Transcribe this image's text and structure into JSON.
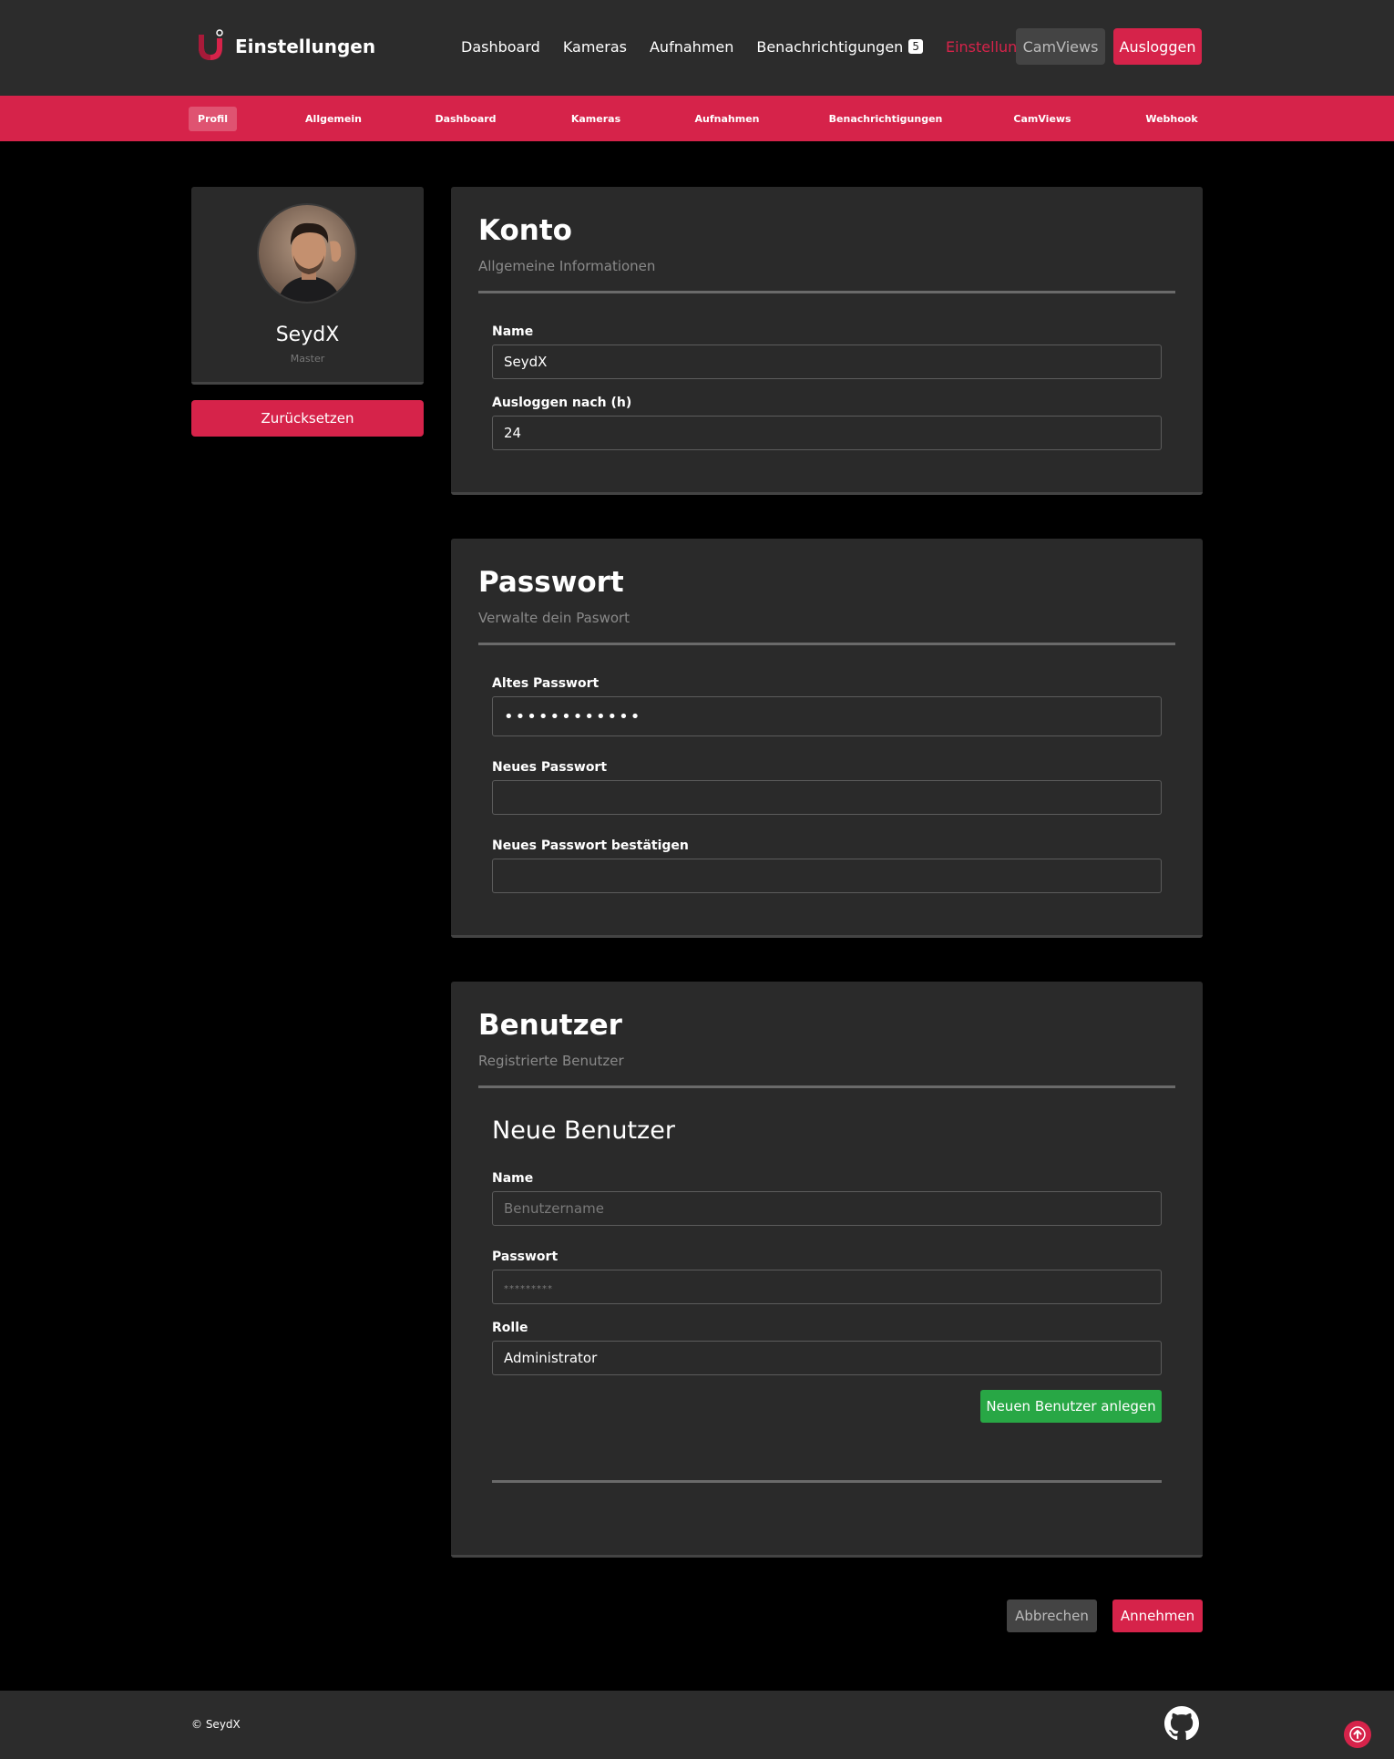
{
  "header": {
    "brand_title": "Einstellungen",
    "nav": [
      {
        "label": "Dashboard"
      },
      {
        "label": "Kameras"
      },
      {
        "label": "Aufnahmen"
      },
      {
        "label": "Benachrichtigungen",
        "badge": "5"
      },
      {
        "label": "Einstellungen",
        "active": true
      }
    ],
    "camviews_label": "CamViews",
    "logout_label": "Ausloggen"
  },
  "subnav": {
    "items": [
      {
        "label": "Profil",
        "active": true
      },
      {
        "label": "Allgemein"
      },
      {
        "label": "Dashboard"
      },
      {
        "label": "Kameras"
      },
      {
        "label": "Aufnahmen"
      },
      {
        "label": "Benachrichtigungen"
      },
      {
        "label": "CamViews"
      },
      {
        "label": "Webhook"
      }
    ]
  },
  "profile": {
    "name": "SeydX",
    "role": "Master",
    "reset_label": "Zurücksetzen"
  },
  "account": {
    "title": "Konto",
    "subtitle": "Allgemeine Informationen",
    "name_label": "Name",
    "name_value": "SeydX",
    "logout_label": "Ausloggen nach (h)",
    "logout_value": "24"
  },
  "password": {
    "title": "Passwort",
    "subtitle": "Verwalte dein Paswort",
    "old_label": "Altes Passwort",
    "old_value": "••••••••••••",
    "new_label": "Neues Passwort",
    "new_value": "",
    "confirm_label": "Neues Passwort bestätigen",
    "confirm_value": ""
  },
  "users": {
    "title": "Benutzer",
    "subtitle": "Registrierte Benutzer",
    "new_user_title": "Neue Benutzer",
    "name_label": "Name",
    "name_placeholder": "Benutzername",
    "password_label": "Passwort",
    "password_placeholder": "*********",
    "role_label": "Rolle",
    "role_value": "Administrator",
    "create_label": "Neuen Benutzer anlegen"
  },
  "actions": {
    "cancel_label": "Abbrechen",
    "accept_label": "Annehmen"
  },
  "footer": {
    "copyright": "© SeydX"
  },
  "colors": {
    "accent": "#d6234a",
    "success": "#28a745",
    "panel": "#2a2a2a",
    "navbar": "#2c2c2c"
  },
  "icons": {
    "brand": "camera-ui-logo",
    "footer": "github-icon",
    "scroll": "arrow-up-icon"
  }
}
